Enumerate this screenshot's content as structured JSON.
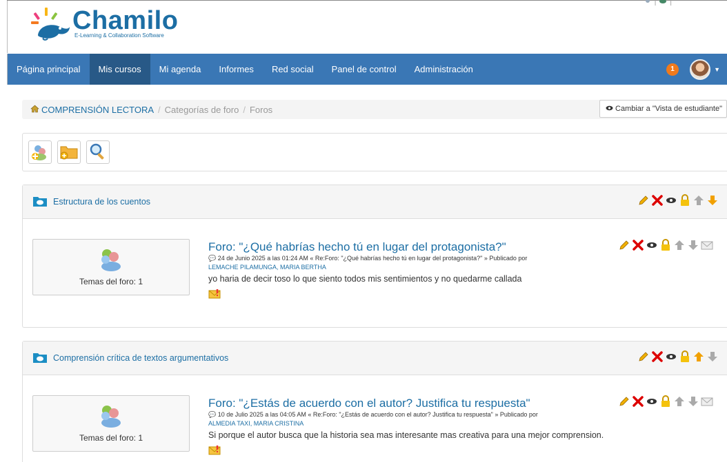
{
  "brand": {
    "name": "Chamilo",
    "tagline": "E-Learning & Collaboration Software"
  },
  "nav": {
    "items": [
      {
        "label": "Página principal"
      },
      {
        "label": "Mis cursos"
      },
      {
        "label": "Mi agenda"
      },
      {
        "label": "Informes"
      },
      {
        "label": "Red social"
      },
      {
        "label": "Panel de control"
      },
      {
        "label": "Administración"
      }
    ],
    "active_index": 1,
    "notification_count": "1"
  },
  "breadcrumb": {
    "course": "COMPRENSIÓN LECTORA",
    "level2": "Categorías de foro",
    "level3": "Foros",
    "separator": "/"
  },
  "student_view_label": "Cambiar a \"Vista de estudiante\"",
  "categories": [
    {
      "title": "Estructura de los cuentos",
      "forum": {
        "title": "Foro: \"¿Qué habrías hecho tú en lugar del protagonista?\"",
        "meta": "24 de Junio 2025 a las 01:24 AM « Re:Foro: \"¿Qué habrías hecho tú en lugar del protagonista?\" » Publicado por",
        "author": "LEMACHE PILAMUNGA, MARIA BERTHA",
        "text": "yo haria de decir toso lo que siento todos mis sentimientos y no quedarme callada",
        "topics_label": "Temas del foro: 1"
      }
    },
    {
      "title": "Comprensión crítica de textos argumentativos",
      "forum": {
        "title": "Foro: \"¿Estás de acuerdo con el autor? Justifica tu respuesta\"",
        "meta": "10 de Julio 2025 a las 04:05 AM « Re:Foro: \"¿Estás de acuerdo con el autor? Justifica tu respuesta\" » Publicado por",
        "author": "ALMEDIA TAXI, MARIA CRISTINA",
        "text": "Si porque el autor busca que la historia sea mas interesante mas creativa para una mejor comprension.",
        "topics_label": "Temas del foro: 1"
      }
    }
  ],
  "colors": {
    "navbar": "#3a77b5",
    "navbar_active": "#285987",
    "link": "#1c6ea4",
    "badge": "#f07a1c"
  }
}
